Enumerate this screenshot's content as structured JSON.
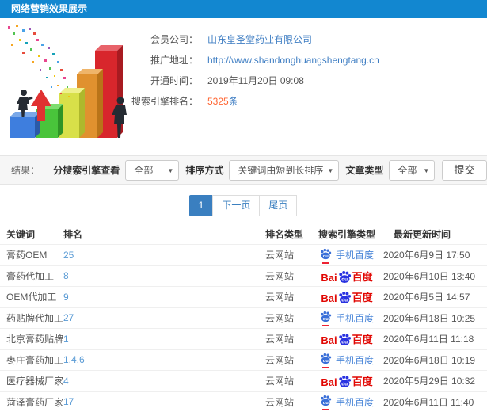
{
  "colors": {
    "titlebar_bg": "#1287d0",
    "link_blue": "#3f7ec3",
    "rank_link": "#5a9bd5",
    "highlight_orange": "#ff6633",
    "baidu_red": "#e10602",
    "baidu_blue": "#2932e1",
    "mobile_baidu_blue": "#3a6fd8",
    "pagination_active": "#3a7fc0"
  },
  "header": {
    "title": "网络营销效果展示"
  },
  "info": {
    "company_label": "会员公司：",
    "company": "山东皇圣堂药业有限公司",
    "url_label": "推广地址：",
    "url": "http://www.shandonghuangshengtang.cn",
    "open_label": "开通时间：",
    "open_time": "2019年11月20日 09:08",
    "rank_label": "搜索引擎排名：",
    "rank_count": "5325",
    "rank_unit": "条"
  },
  "filters": {
    "result_label": "结果：",
    "engine_label": "分搜索引擎查看",
    "engine_value": "全部",
    "sort_label": "排序方式",
    "sort_value": "关键词由短到长排序",
    "article_label": "文章类型",
    "article_value": "全部",
    "caret": "▼",
    "submit": "提交"
  },
  "pagination": {
    "current": "1",
    "next": "下一页",
    "last": "尾页"
  },
  "engines": {
    "mobile": {
      "label": "手机百度",
      "du": "du"
    },
    "pc": {
      "bai": "Bai",
      "du": "du",
      "baidu": "百度"
    }
  },
  "table": {
    "headers": [
      "关键词",
      "排名",
      "排名类型",
      "搜索引擎类型",
      "最新更新时间"
    ],
    "rows": [
      {
        "keyword": "膏药OEM",
        "rank": "25",
        "rank_type": "云网站",
        "engine": "mobile",
        "updated": "2020年6月9日 17:50"
      },
      {
        "keyword": "膏药代加工",
        "rank": "8",
        "rank_type": "云网站",
        "engine": "pc",
        "updated": "2020年6月10日 13:40"
      },
      {
        "keyword": "OEM代加工",
        "rank": "9",
        "rank_type": "云网站",
        "engine": "pc",
        "updated": "2020年6月5日 14:57"
      },
      {
        "keyword": "药贴牌代加工",
        "rank": "27",
        "rank_type": "云网站",
        "engine": "mobile",
        "updated": "2020年6月18日 10:25"
      },
      {
        "keyword": "北京膏药贴牌",
        "rank": "1",
        "rank_type": "云网站",
        "engine": "pc",
        "updated": "2020年6月11日 11:18"
      },
      {
        "keyword": "枣庄膏药加工",
        "rank": "1,4,6",
        "rank_type": "云网站",
        "engine": "mobile",
        "updated": "2020年6月18日 10:19"
      },
      {
        "keyword": "医疗器械厂家",
        "rank": "4",
        "rank_type": "云网站",
        "engine": "pc",
        "updated": "2020年5月29日 10:32"
      },
      {
        "keyword": "菏泽膏药厂家",
        "rank": "17",
        "rank_type": "云网站",
        "engine": "mobile",
        "updated": "2020年6月11日 11:40"
      }
    ]
  }
}
